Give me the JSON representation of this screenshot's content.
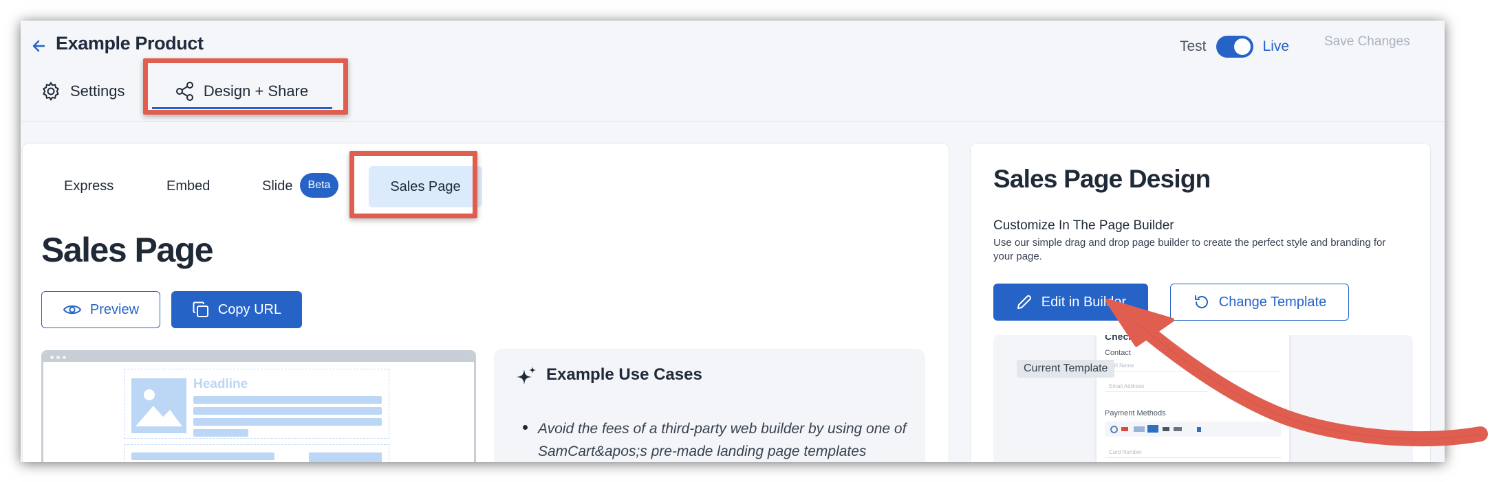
{
  "header": {
    "back_icon": "arrow-left-icon",
    "title": "Example Product",
    "mode_test": "Test",
    "mode_live": "Live",
    "save_label": "Save Changes"
  },
  "tabs": {
    "settings": "Settings",
    "design": "Design + Share"
  },
  "sub_tabs": {
    "express": "Express",
    "embed": "Embed",
    "slide": "Slide",
    "beta_badge": "Beta",
    "sales_page": "Sales Page"
  },
  "main": {
    "heading": "Sales Page",
    "preview_label": "Preview",
    "copy_url_label": "Copy URL",
    "mockup": {
      "headline": "Headline"
    },
    "use_cases": {
      "title": "Example Use Cases",
      "item1": "Avoid the fees of a third-party web builder by using one of SamCart&apos;s pre-made landing page templates"
    }
  },
  "right": {
    "title": "Sales Page Design",
    "subtitle": "Customize In The Page Builder",
    "description": "Use our simple drag and drop page builder to create the perfect style and branding for your page.",
    "edit_label": "Edit in Builder",
    "change_label": "Change Template",
    "current_template_badge": "Current Template",
    "template_preview": {
      "checkout": "Checkout",
      "contact": "Contact",
      "full_name": "Full Name",
      "email": "Email Address",
      "payment_methods": "Payment Methods",
      "card_number": "Card Number"
    }
  },
  "colors": {
    "accent": "#2563c7",
    "highlight_annotation": "#e05e50",
    "page_bg": "#f4f6f9"
  }
}
